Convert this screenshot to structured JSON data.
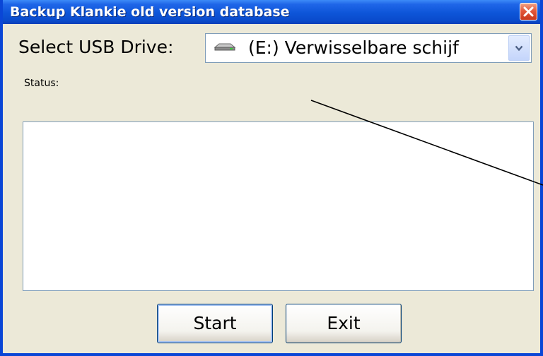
{
  "window": {
    "title": "Backup Klankie old version database"
  },
  "form": {
    "usb_label": "Select USB Drive:",
    "drive_selected": "(E:) Verwisselbare schijf",
    "status_label": "Status:",
    "status_text": ""
  },
  "buttons": {
    "start_label": "Start",
    "exit_label": "Exit"
  },
  "icons": {
    "close": "close-icon",
    "drive": "removable-drive-icon",
    "dropdown": "chevron-down-icon"
  },
  "colors": {
    "titlebar": "#0a4bcc",
    "close_button": "#e3573a",
    "dialog_bg": "#ece9d8",
    "field_border": "#7f9db9"
  }
}
